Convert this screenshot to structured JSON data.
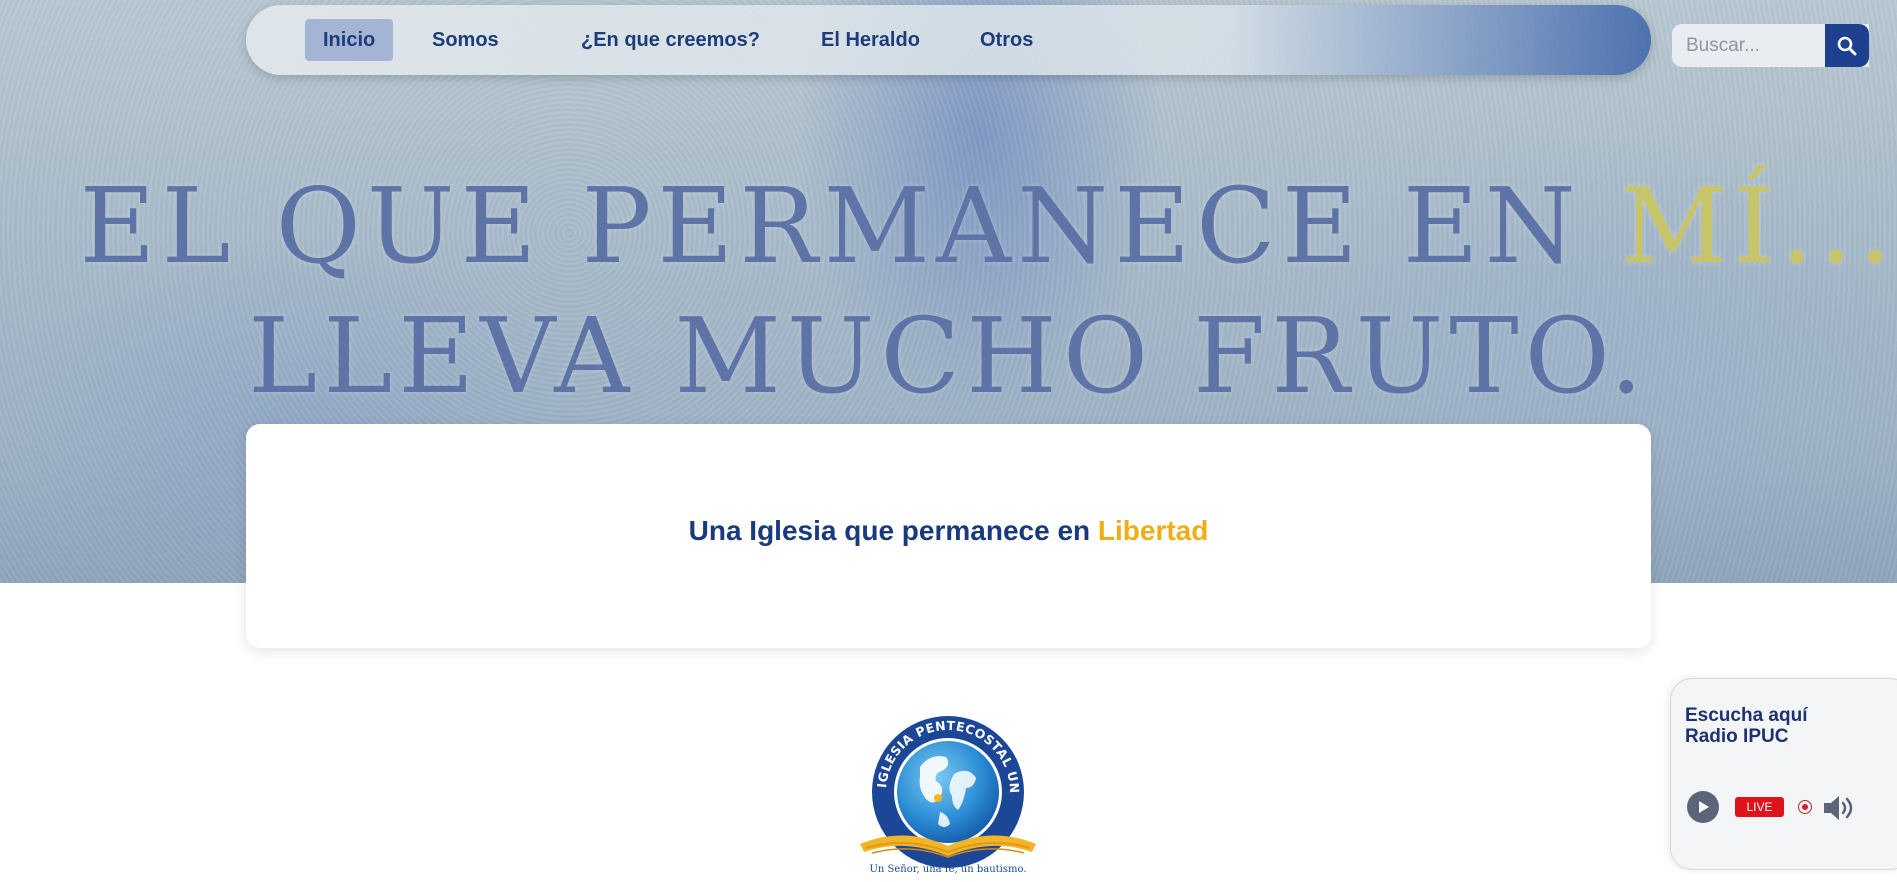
{
  "nav": {
    "items": [
      {
        "label": "Inicio",
        "active": true
      },
      {
        "label": "Somos",
        "active": false
      },
      {
        "label": "¿En que creemos?",
        "active": false
      },
      {
        "label": "El Heraldo",
        "active": false
      },
      {
        "label": "Otros",
        "active": false
      }
    ],
    "search_placeholder": "Buscar...",
    "search_icon": "search-icon"
  },
  "hero": {
    "line1_main": "EL QUE PERMANECE EN ",
    "line1_highlight": "MÍ...",
    "line2": "LLEVA MUCHO FRUTO."
  },
  "card": {
    "tagline_main": "Una Iglesia que permanece en ",
    "tagline_highlight": "Libertad"
  },
  "logo": {
    "ring_text": "IGLESIA PENTECOSTAL UNIDA DE COLOMBIA",
    "motto": "Un Señor, una fe, un bautismo."
  },
  "radio": {
    "line1": "Escucha aquí",
    "line2": "Radio IPUC",
    "live_label": "LIVE",
    "icons": [
      "play-icon",
      "record-icon",
      "volume-icon"
    ]
  },
  "colors": {
    "brand_blue": "#1a3a7e",
    "accent_gold": "#efae15",
    "nav_active_bg": "#a3b4d4",
    "search_button": "#1f3f8f",
    "live_red": "#e0131c"
  }
}
